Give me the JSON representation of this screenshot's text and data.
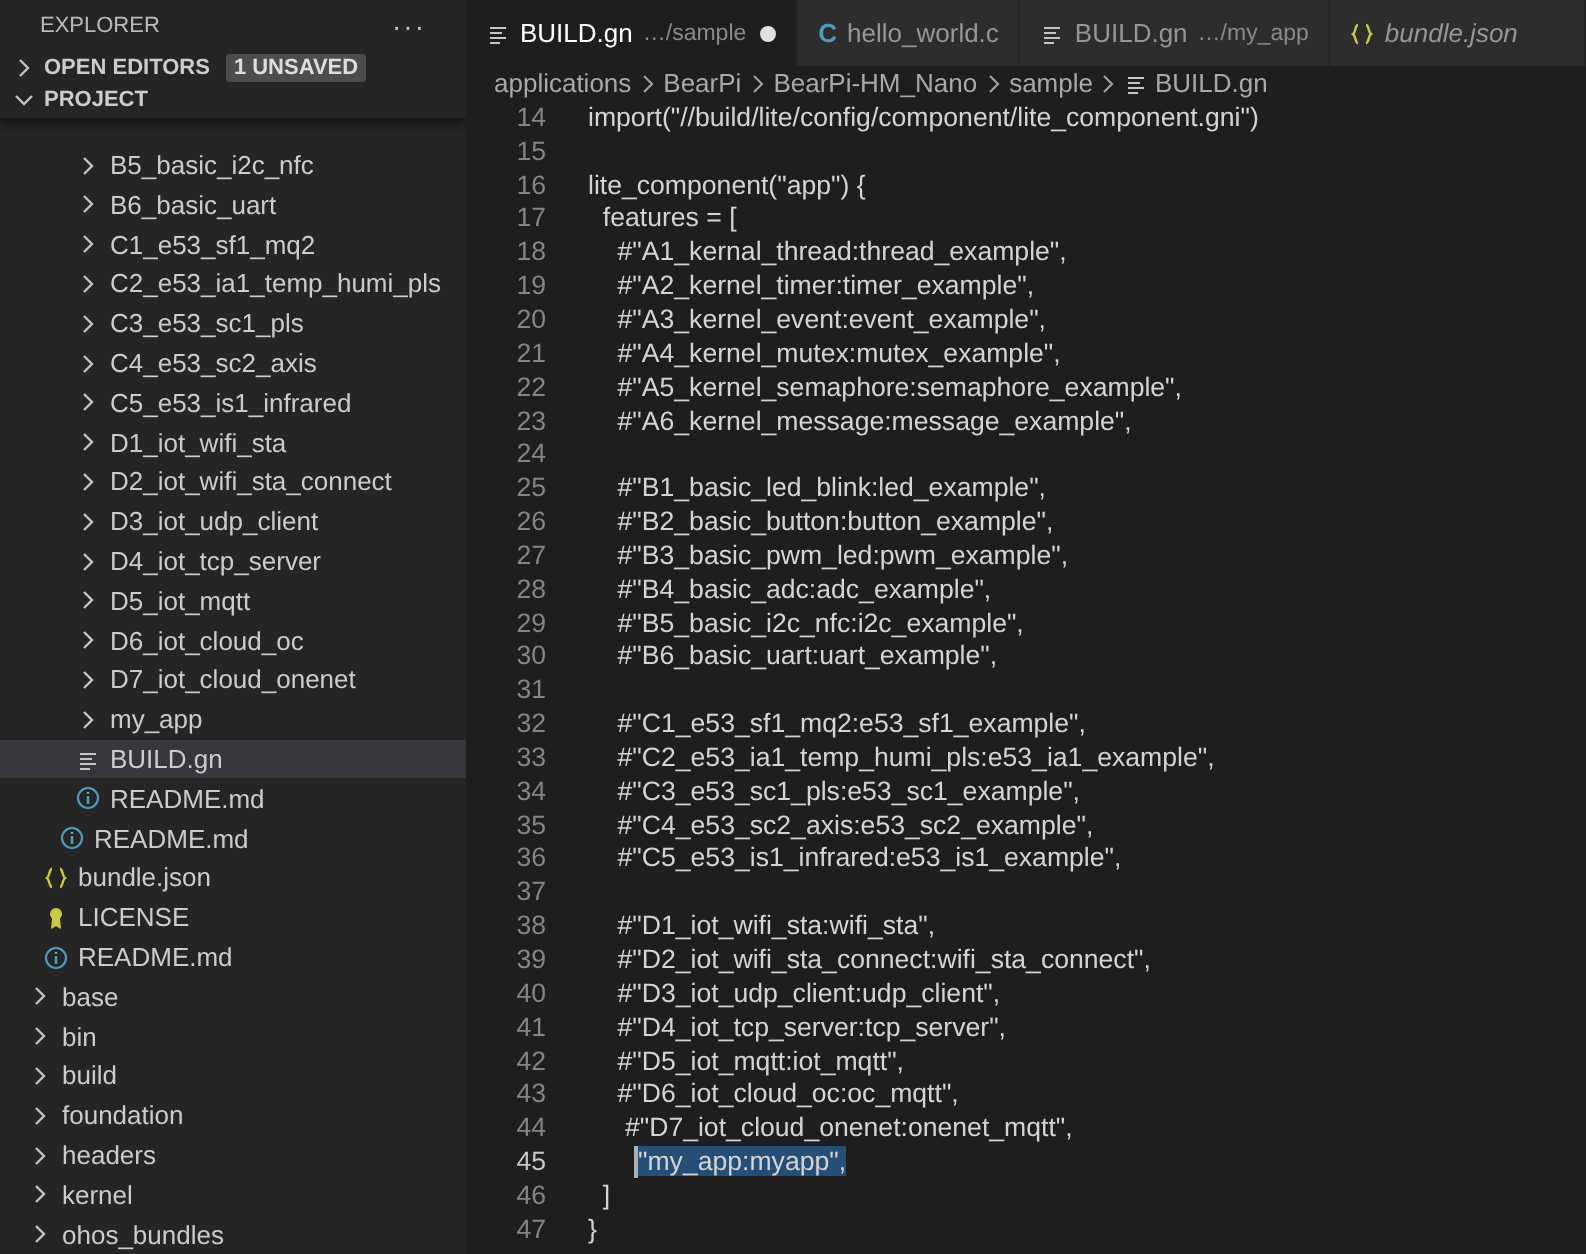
{
  "sidebar": {
    "title": "EXPLORER",
    "more": "···",
    "sections": [
      {
        "label": "OPEN EDITORS",
        "expanded": false,
        "badge": "1 UNSAVED"
      },
      {
        "label": "PROJECT",
        "expanded": true
      }
    ],
    "tree": [
      {
        "children": [
          {
            "children": [
              {
                "children": [
                  {
                    "label": "B5_basic_i2c_nfc",
                    "kind": "folder",
                    "expanded": false,
                    "selected": false
                  },
                  {
                    "label": "B6_basic_uart",
                    "kind": "folder",
                    "expanded": false,
                    "selected": false
                  },
                  {
                    "label": "C1_e53_sf1_mq2",
                    "kind": "folder",
                    "expanded": false,
                    "selected": false
                  },
                  {
                    "label": "C2_e53_ia1_temp_humi_pls",
                    "kind": "folder",
                    "expanded": false,
                    "selected": false
                  },
                  {
                    "label": "C3_e53_sc1_pls",
                    "kind": "folder",
                    "expanded": false,
                    "selected": false
                  },
                  {
                    "label": "C4_e53_sc2_axis",
                    "kind": "folder",
                    "expanded": false,
                    "selected": false
                  },
                  {
                    "label": "C5_e53_is1_infrared",
                    "kind": "folder",
                    "expanded": false,
                    "selected": false
                  },
                  {
                    "label": "D1_iot_wifi_sta",
                    "kind": "folder",
                    "expanded": false,
                    "selected": false
                  },
                  {
                    "label": "D2_iot_wifi_sta_connect",
                    "kind": "folder",
                    "expanded": false,
                    "selected": false
                  },
                  {
                    "label": "D3_iot_udp_client",
                    "kind": "folder",
                    "expanded": false,
                    "selected": false
                  },
                  {
                    "label": "D4_iot_tcp_server",
                    "kind": "folder",
                    "expanded": false,
                    "selected": false
                  },
                  {
                    "label": "D5_iot_mqtt",
                    "kind": "folder",
                    "expanded": false,
                    "selected": false
                  },
                  {
                    "label": "D6_iot_cloud_oc",
                    "kind": "folder",
                    "expanded": false,
                    "selected": false
                  },
                  {
                    "label": "D7_iot_cloud_onenet",
                    "kind": "folder",
                    "expanded": false,
                    "selected": false
                  },
                  {
                    "label": "my_app",
                    "kind": "folder",
                    "expanded": false,
                    "selected": false
                  },
                  {
                    "label": "BUILD.gn",
                    "kind": "lines",
                    "selected": true
                  },
                  {
                    "label": "README.md",
                    "kind": "info",
                    "selected": false
                  }
                ]
              },
              {
                "label": "README.md",
                "kind": "info",
                "selected": false
              }
            ]
          },
          {
            "label": "bundle.json",
            "kind": "braces",
            "selected": false
          },
          {
            "label": "LICENSE",
            "kind": "license",
            "selected": false
          },
          {
            "label": "README.md",
            "kind": "info",
            "selected": false
          }
        ]
      },
      {
        "label": "base",
        "kind": "folder",
        "expanded": false,
        "selected": false
      },
      {
        "label": "bin",
        "kind": "folder",
        "expanded": false,
        "selected": false
      },
      {
        "label": "build",
        "kind": "folder",
        "expanded": false,
        "selected": false
      },
      {
        "label": "foundation",
        "kind": "folder",
        "expanded": false,
        "selected": false
      },
      {
        "label": "headers",
        "kind": "folder",
        "expanded": false,
        "selected": false
      },
      {
        "label": "kernel",
        "kind": "folder",
        "expanded": false,
        "selected": false
      },
      {
        "label": "ohos_bundles",
        "kind": "folder",
        "expanded": false,
        "selected": false
      }
    ]
  },
  "tabs": [
    {
      "label": "BUILD.gn",
      "description": "…/sample",
      "kind": "lines",
      "selected": true,
      "modified": true,
      "preview": false
    },
    {
      "label": "hello_world.c",
      "kind": "glyph",
      "glyph": "C",
      "selected": false,
      "modified": false,
      "preview": false
    },
    {
      "label": "BUILD.gn",
      "description": "…/my_app",
      "kind": "lines",
      "selected": false,
      "modified": false,
      "preview": false
    },
    {
      "label": "bundle.json",
      "kind": "braces",
      "selected": false,
      "modified": false,
      "preview": true
    }
  ],
  "breadcrumbs": [
    {
      "label": "applications",
      "kind": "folder"
    },
    {
      "label": "BearPi",
      "kind": "folder"
    },
    {
      "label": "BearPi-HM_Nano",
      "kind": "folder"
    },
    {
      "label": "sample",
      "kind": "folder"
    },
    {
      "label": "BUILD.gn",
      "kind": "lines"
    }
  ],
  "editor": {
    "lines": [
      {
        "number": "14",
        "text": "import(\"//build/lite/config/component/lite_component.gni\")"
      },
      {
        "number": "15"
      },
      {
        "number": "16",
        "text": "lite_component(\"app\") {"
      },
      {
        "number": "17",
        "text": "  features = ["
      },
      {
        "number": "18",
        "text": "    #\"A1_kernal_thread:thread_example\","
      },
      {
        "number": "19",
        "text": "    #\"A2_kernel_timer:timer_example\","
      },
      {
        "number": "20",
        "text": "    #\"A3_kernel_event:event_example\","
      },
      {
        "number": "21",
        "text": "    #\"A4_kernel_mutex:mutex_example\","
      },
      {
        "number": "22",
        "text": "    #\"A5_kernel_semaphore:semaphore_example\","
      },
      {
        "number": "23",
        "text": "    #\"A6_kernel_message:message_example\","
      },
      {
        "number": "24"
      },
      {
        "number": "25",
        "text": "    #\"B1_basic_led_blink:led_example\","
      },
      {
        "number": "26",
        "text": "    #\"B2_basic_button:button_example\","
      },
      {
        "number": "27",
        "text": "    #\"B3_basic_pwm_led:pwm_example\","
      },
      {
        "number": "28",
        "text": "    #\"B4_basic_adc:adc_example\","
      },
      {
        "number": "29",
        "text": "    #\"B5_basic_i2c_nfc:i2c_example\","
      },
      {
        "number": "30",
        "text": "    #\"B6_basic_uart:uart_example\","
      },
      {
        "number": "31"
      },
      {
        "number": "32",
        "text": "    #\"C1_e53_sf1_mq2:e53_sf1_example\","
      },
      {
        "number": "33",
        "text": "    #\"C2_e53_ia1_temp_humi_pls:e53_ia1_example\","
      },
      {
        "number": "34",
        "text": "    #\"C3_e53_sc1_pls:e53_sc1_example\","
      },
      {
        "number": "35",
        "text": "    #\"C4_e53_sc2_axis:e53_sc2_example\","
      },
      {
        "number": "36",
        "text": "    #\"C5_e53_is1_infrared:e53_is1_example\","
      },
      {
        "number": "37"
      },
      {
        "number": "38",
        "text": "    #\"D1_iot_wifi_sta:wifi_sta\","
      },
      {
        "number": "39",
        "text": "    #\"D2_iot_wifi_sta_connect:wifi_sta_connect\","
      },
      {
        "number": "40",
        "text": "    #\"D3_iot_udp_client:udp_client\","
      },
      {
        "number": "41",
        "text": "    #\"D4_iot_tcp_server:tcp_server\","
      },
      {
        "number": "42",
        "text": "    #\"D5_iot_mqtt:iot_mqtt\","
      },
      {
        "number": "43",
        "text": "    #\"D6_iot_cloud_oc:oc_mqtt\","
      },
      {
        "number": "44",
        "text": "     #\"D7_iot_cloud_onenet:onenet_mqtt\","
      },
      {
        "number": "45",
        "selection": "\"my_app:myapp\",",
        "current": true
      },
      {
        "number": "46",
        "text": "  ]"
      },
      {
        "number": "47",
        "text": "}"
      }
    ]
  }
}
